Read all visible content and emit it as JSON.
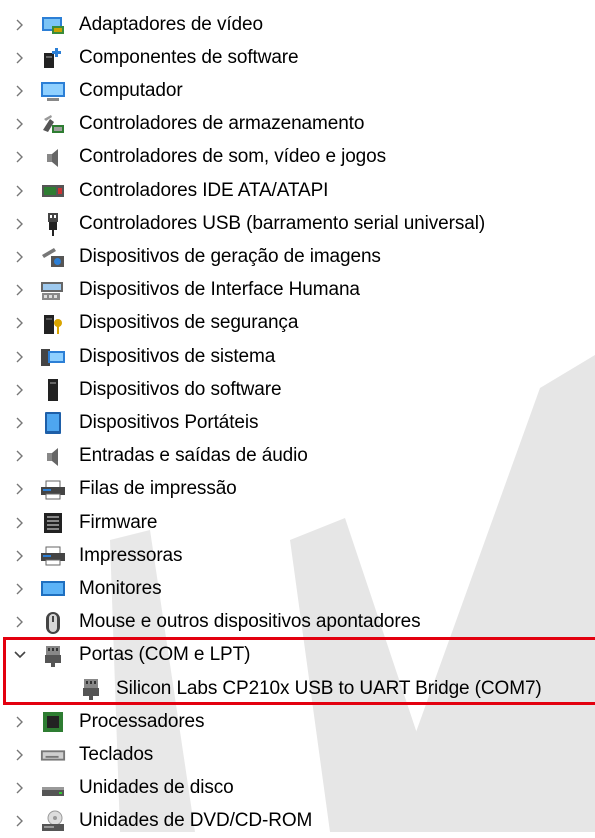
{
  "device_tree": {
    "categories": [
      {
        "label": "Adaptadores de vídeo",
        "icon": "display-adapter-icon",
        "expanded": false
      },
      {
        "label": "Componentes de software",
        "icon": "software-component-icon",
        "expanded": false
      },
      {
        "label": "Computador",
        "icon": "computer-icon",
        "expanded": false
      },
      {
        "label": "Controladores de armazenamento",
        "icon": "storage-controller-icon",
        "expanded": false
      },
      {
        "label": "Controladores de som, vídeo e jogos",
        "icon": "speaker-icon",
        "expanded": false
      },
      {
        "label": "Controladores IDE ATA/ATAPI",
        "icon": "ide-controller-icon",
        "expanded": false
      },
      {
        "label": "Controladores USB (barramento serial universal)",
        "icon": "usb-icon",
        "expanded": false
      },
      {
        "label": "Dispositivos de geração de imagens",
        "icon": "camera-icon",
        "expanded": false
      },
      {
        "label": "Dispositivos de Interface Humana",
        "icon": "hid-icon",
        "expanded": false
      },
      {
        "label": "Dispositivos de segurança",
        "icon": "security-key-icon",
        "expanded": false
      },
      {
        "label": "Dispositivos de sistema",
        "icon": "system-devices-icon",
        "expanded": false
      },
      {
        "label": "Dispositivos do software",
        "icon": "software-device-icon",
        "expanded": false
      },
      {
        "label": "Dispositivos Portáteis",
        "icon": "portable-device-icon",
        "expanded": false
      },
      {
        "label": "Entradas e saídas de áudio",
        "icon": "speaker-icon",
        "expanded": false
      },
      {
        "label": "Filas de impressão",
        "icon": "printer-icon",
        "expanded": false
      },
      {
        "label": "Firmware",
        "icon": "firmware-icon",
        "expanded": false
      },
      {
        "label": "Impressoras",
        "icon": "printer-icon",
        "expanded": false
      },
      {
        "label": "Monitores",
        "icon": "monitor-icon",
        "expanded": false
      },
      {
        "label": "Mouse e outros dispositivos apontadores",
        "icon": "mouse-icon",
        "expanded": false
      },
      {
        "label": "Portas (COM e LPT)",
        "icon": "port-icon",
        "expanded": true,
        "children": [
          {
            "label": "Silicon Labs CP210x USB to UART Bridge (COM7)",
            "icon": "port-icon"
          }
        ]
      },
      {
        "label": "Processadores",
        "icon": "processor-icon",
        "expanded": false
      },
      {
        "label": "Teclados",
        "icon": "keyboard-icon",
        "expanded": false
      },
      {
        "label": "Unidades de disco",
        "icon": "disk-drive-icon",
        "expanded": false
      },
      {
        "label": "Unidades de DVD/CD-ROM",
        "icon": "dvd-drive-icon",
        "expanded": false
      }
    ]
  },
  "colors": {
    "highlight_border": "#e3000f",
    "text": "#000000",
    "chevron": "#555555",
    "watermark": "#e6e6e6"
  }
}
